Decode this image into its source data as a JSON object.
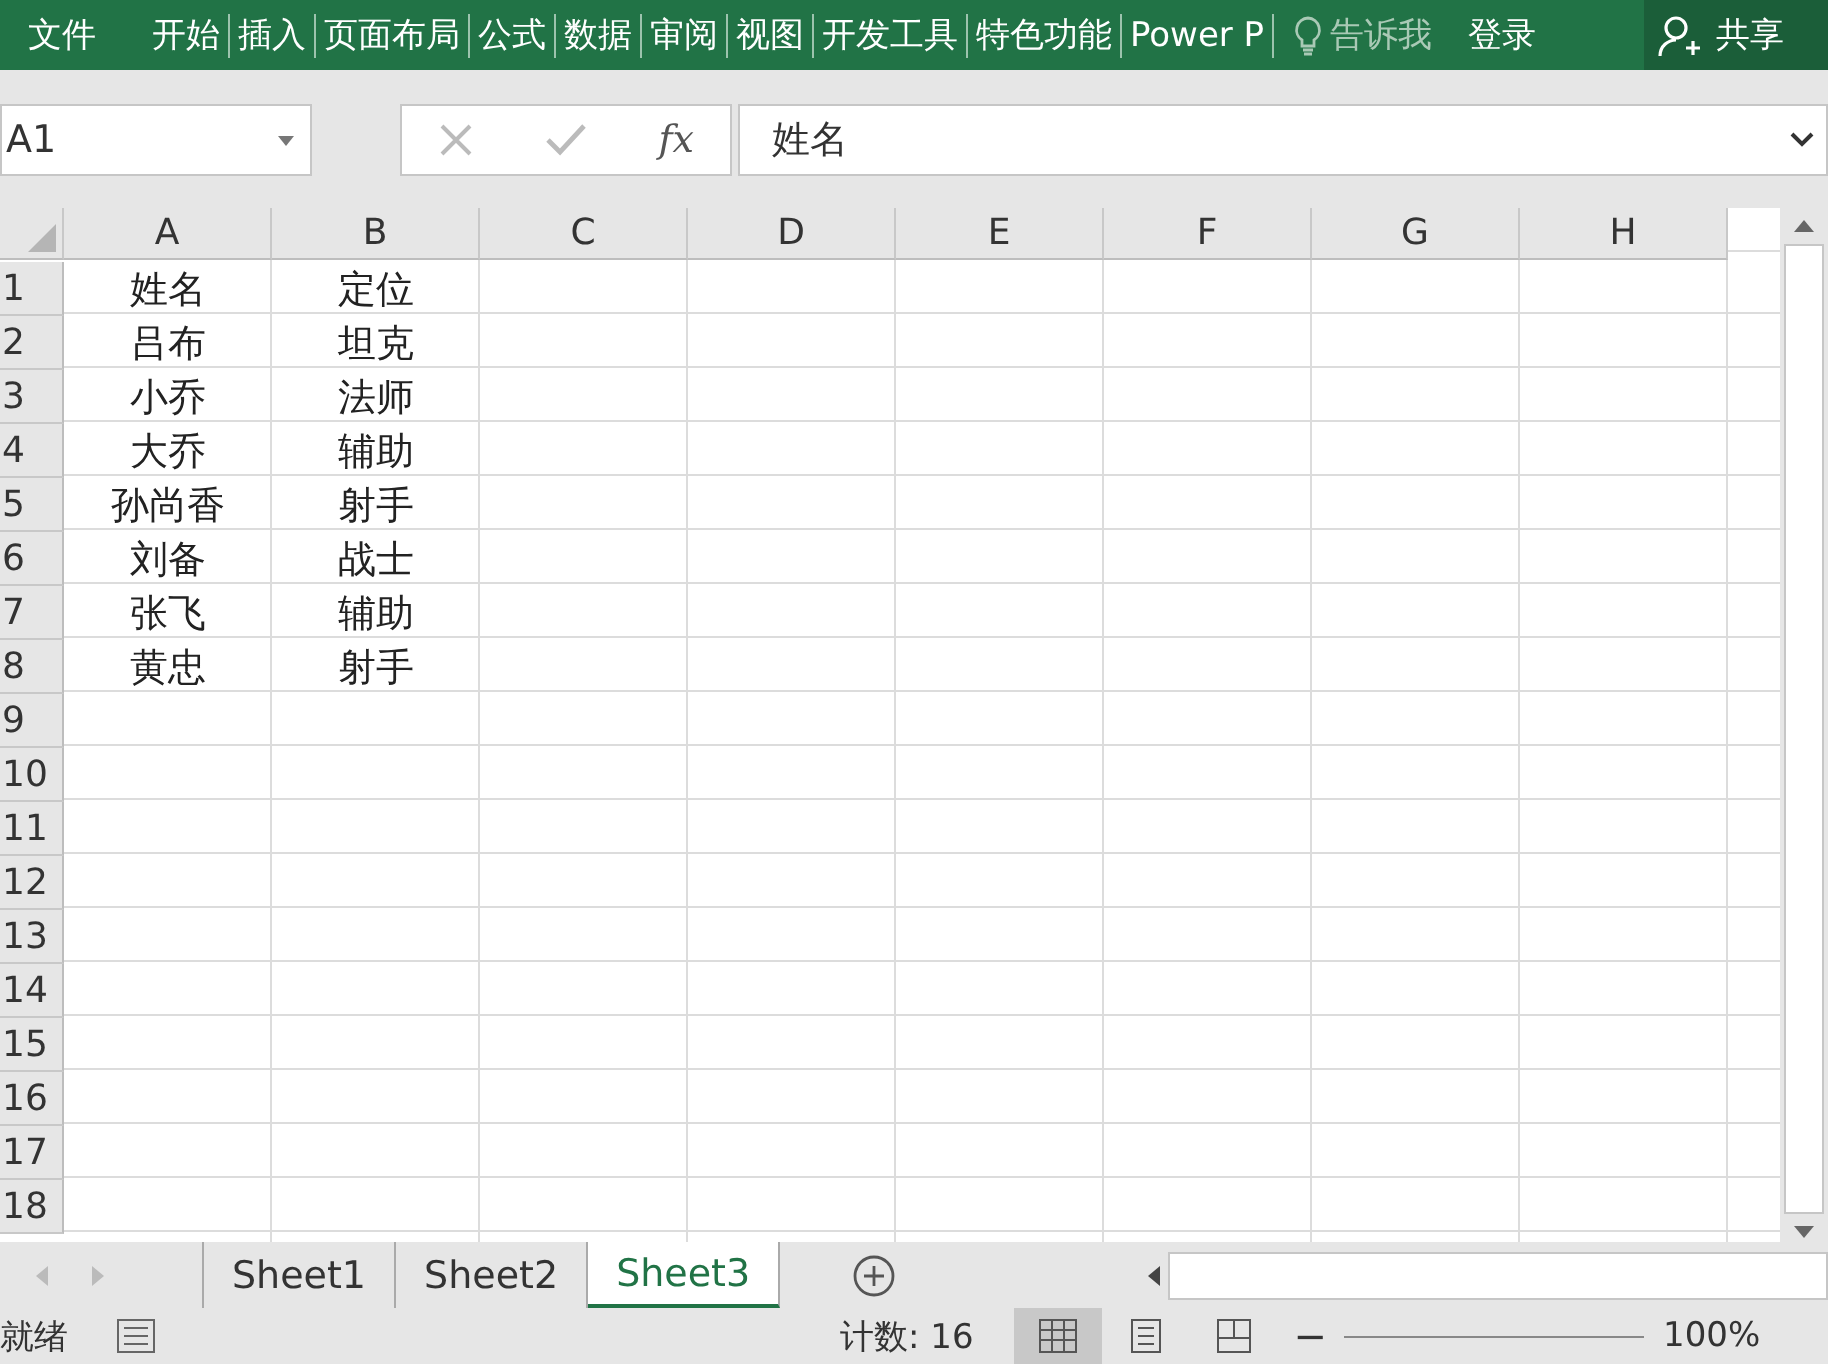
{
  "ribbon": {
    "tabs": [
      {
        "label": "文件",
        "kind": "file"
      },
      {
        "label": "开始",
        "kind": "tab"
      },
      {
        "label": "插入",
        "kind": "tab"
      },
      {
        "label": "页面布局",
        "kind": "tab"
      },
      {
        "label": "公式",
        "kind": "tab"
      },
      {
        "label": "数据",
        "kind": "tab"
      },
      {
        "label": "审阅",
        "kind": "tab"
      },
      {
        "label": "视图",
        "kind": "tab"
      },
      {
        "label": "开发工具",
        "kind": "tab"
      },
      {
        "label": "特色功能",
        "kind": "tab"
      },
      {
        "label": "Power P",
        "kind": "tab"
      }
    ],
    "tell_me": "告诉我",
    "login": "登录",
    "share": "共享"
  },
  "formula_bar": {
    "name_box": "A1",
    "function_label": "fx",
    "value": "姓名"
  },
  "sheet": {
    "columns": [
      "A",
      "B",
      "C",
      "D",
      "E",
      "F",
      "G",
      "H"
    ],
    "rows": [
      {
        "number": "1",
        "cells": [
          "姓名",
          "定位"
        ]
      },
      {
        "number": "2",
        "cells": [
          "吕布",
          "坦克"
        ]
      },
      {
        "number": "3",
        "cells": [
          "小乔",
          "法师"
        ]
      },
      {
        "number": "4",
        "cells": [
          "大乔",
          "辅助"
        ]
      },
      {
        "number": "5",
        "cells": [
          "孙尚香",
          "射手"
        ]
      },
      {
        "number": "6",
        "cells": [
          "刘备",
          "战士"
        ]
      },
      {
        "number": "7",
        "cells": [
          "张飞",
          "辅助"
        ]
      },
      {
        "number": "8",
        "cells": [
          "黄忠",
          "射手"
        ]
      },
      {
        "number": "9",
        "cells": []
      },
      {
        "number": "10",
        "cells": []
      },
      {
        "number": "11",
        "cells": []
      },
      {
        "number": "12",
        "cells": []
      },
      {
        "number": "13",
        "cells": []
      },
      {
        "number": "14",
        "cells": []
      },
      {
        "number": "15",
        "cells": []
      },
      {
        "number": "16",
        "cells": []
      },
      {
        "number": "17",
        "cells": []
      },
      {
        "number": "18",
        "cells": []
      }
    ]
  },
  "sheet_tabs": [
    {
      "label": "Sheet1",
      "selected": false
    },
    {
      "label": "Sheet2",
      "selected": false
    },
    {
      "label": "Sheet3",
      "selected": true
    }
  ],
  "status_bar": {
    "ready": "就绪",
    "count": "计数: 16",
    "zoom_out": "−",
    "zoom": "100%"
  }
}
